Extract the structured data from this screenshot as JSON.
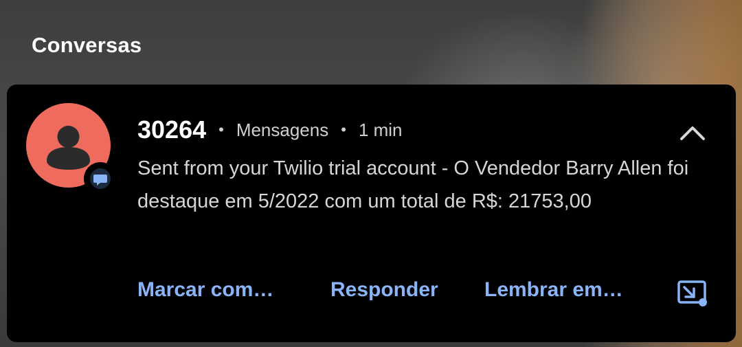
{
  "section": {
    "title": "Conversas"
  },
  "notification": {
    "sender": "30264",
    "app_name": "Mensagens",
    "time": "1 min",
    "separator": "•",
    "message": "Sent from your Twilio trial account - O Vendedor Barry Allen foi destaque em 5/2022 com um total de R$: 21753,00",
    "avatar_icon": "person-icon",
    "app_badge_icon": "chat-bubble-icon",
    "expand_icon": "chevron-up-icon",
    "avatar_color": "#ee6b5e",
    "accent_color": "#8ab4f8",
    "actions": [
      {
        "label": "Marcar com…"
      },
      {
        "label": "Responder"
      },
      {
        "label": "Lembrar em…"
      }
    ],
    "extra_action_icon": "screen-share-icon"
  }
}
